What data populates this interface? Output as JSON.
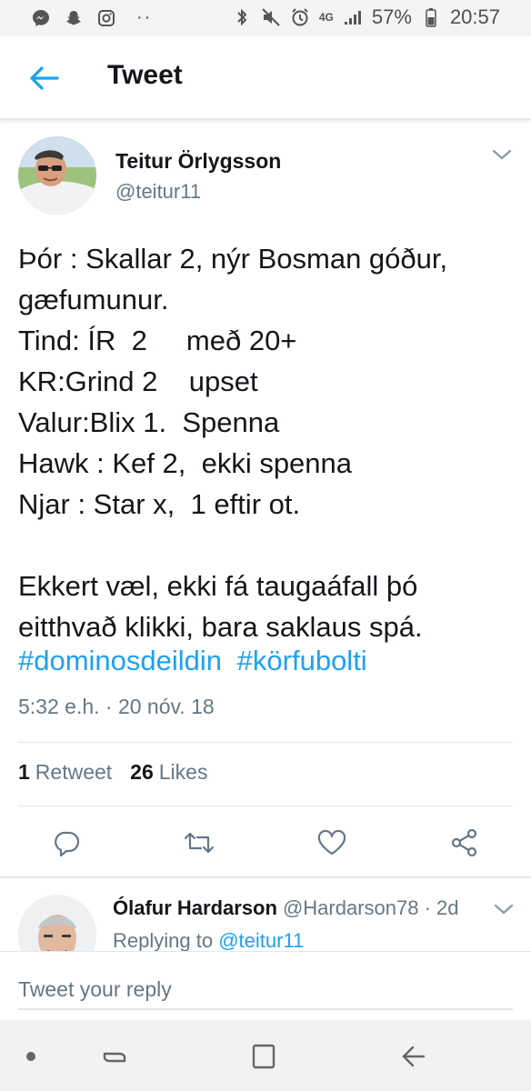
{
  "status_bar": {
    "left_icons": [
      "messenger-icon",
      "snapchat-icon",
      "instagram-icon"
    ],
    "overflow": "··",
    "network": "4G",
    "battery": "57%",
    "time": "20:57"
  },
  "header": {
    "title": "Tweet"
  },
  "tweet": {
    "author_name": "Teitur Örlygsson",
    "author_handle": "@teitur11",
    "body": "Þór : Skallar 2, nýr Bosman góður,\ngæfumunur.\nTind: ÍR  2     með 20+\nKR:Grind 2    upset\nValur:Blix 1.  Spenna\nHawk : Kef 2,  ekki spenna\nNjar : Star x,  1 eftir ot.\n\nEkkert væl, ekki fá taugaáfall þó\neitthvað klikki, bara saklaus spá.",
    "hashtags": [
      "#dominosdeildin",
      "#körfubolti"
    ],
    "timestamp": "5:32 e.h. · 20 nóv. 18",
    "retweet_count": "1",
    "retweet_label": "Retweet",
    "likes_count": "26",
    "likes_label": "Likes"
  },
  "reply": {
    "author_name": "Ólafur Hardarson",
    "author_handle": "@Hardarson78",
    "age": "· 2d",
    "replying_prefix": "Replying to",
    "replying_to": "@teitur11"
  },
  "compose": {
    "placeholder": "Tweet your reply"
  },
  "colors": {
    "accent": "#1da1f2",
    "text": "#14171a",
    "muted": "#657786"
  }
}
